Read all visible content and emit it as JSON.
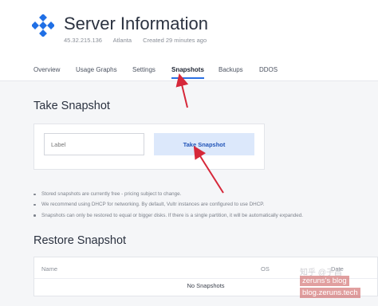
{
  "server": {
    "title": "Server Information",
    "ip": "45.32.215.136",
    "location": "Atlanta",
    "created": "Created 29 minutes ago"
  },
  "tabs": [
    {
      "label": "Overview",
      "active": false
    },
    {
      "label": "Usage Graphs",
      "active": false
    },
    {
      "label": "Settings",
      "active": false
    },
    {
      "label": "Snapshots",
      "active": true
    },
    {
      "label": "Backups",
      "active": false
    },
    {
      "label": "DDOS",
      "active": false
    }
  ],
  "take_snapshot": {
    "heading": "Take Snapshot",
    "label_placeholder": "Label",
    "button_label": "Take Snapshot"
  },
  "notes": [
    "Stored snapshots are currently free - pricing subject to change.",
    "We recommend using DHCP for networking. By default, Vultr instances are configured to use DHCP.",
    "Snapshots can only be restored to equal or bigger disks. If there is a single partition, it will be automatically expanded."
  ],
  "restore_snapshot": {
    "heading": "Restore Snapshot",
    "columns": [
      "Name",
      "OS",
      "Date"
    ],
    "empty_text": "No Snapshots"
  },
  "watermark": {
    "zhihu": "知乎 @子昌",
    "blog_line1": "zeruns's blog",
    "blog_line2": "blog.zeruns.tech"
  },
  "colors": {
    "accent": "#2a6fe3",
    "button_bg": "#dce8fb",
    "arrow": "#d6283a",
    "logo": "#1f6fe5"
  }
}
